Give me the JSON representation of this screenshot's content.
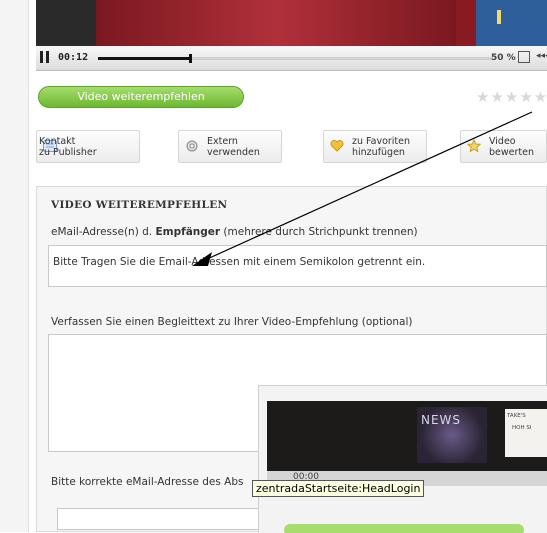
{
  "player": {
    "time": "00:12",
    "progress_fraction": 0.23,
    "zoom": "50 %",
    "fullscreen_icon": "fullscreen-icon",
    "volume_icon": "volume-icon"
  },
  "recommend_button": "Video weiterempfehlen",
  "rating_stars": "★★★★★",
  "actions": [
    {
      "line1": "Kontakt",
      "line2": "zu Publisher",
      "icon": "contact-icon"
    },
    {
      "line1": "Extern",
      "line2": "verwenden",
      "icon": "gear-icon"
    },
    {
      "line1": "zu Favoriten",
      "line2": "hinzufügen",
      "icon": "heart-icon"
    },
    {
      "line1": "Video",
      "line2": "bewerten",
      "icon": "rate-icon"
    }
  ],
  "form": {
    "heading": "VIDEO WEITEREMPFEHLEN",
    "recipients_label_pre": "eMail-Adresse(n) d.",
    "recipients_label_bold": "Empfänger",
    "recipients_label_post": "(mehrere durch Strichpunkt trennen)",
    "recipients_value": "Bitte Tragen Sie die Email-Adressen mit einem Semikolon getrennt ein.",
    "message_label": "Verfassen Sie einen Begleittext zu Ihrer Video-Empfehlung (optional)",
    "message_value": "",
    "sender_label": "Bitte korrekte eMail-Adresse des Abs",
    "sender_value": ""
  },
  "thumbnail": {
    "news_text": "NEWS",
    "tile_line1": "TAKE'S",
    "tile_line2": "HOH SI",
    "time": "00:00"
  },
  "tooltip": "zentradaStartseite:HeadLogin",
  "colors": {
    "accent_green": "#6cb832",
    "video_red": "#8a1a22"
  }
}
